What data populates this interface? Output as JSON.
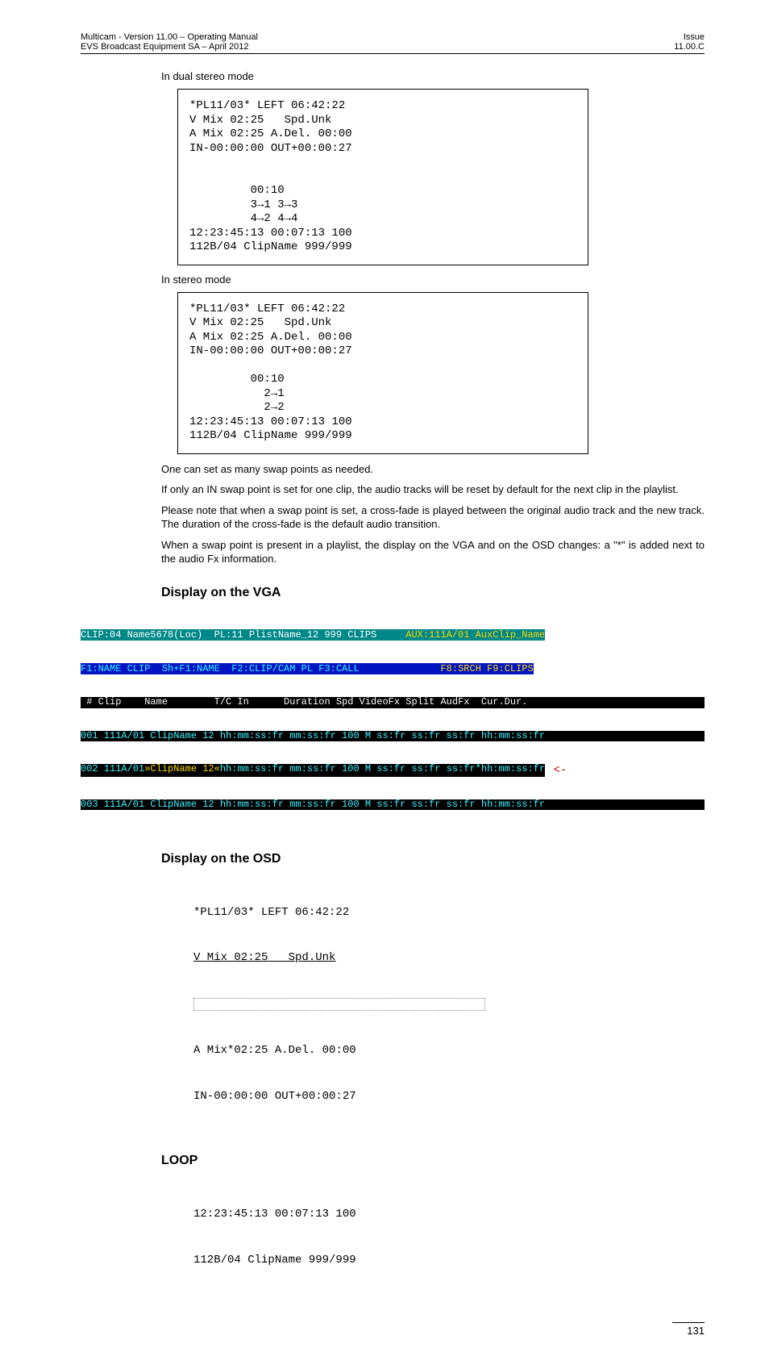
{
  "header": {
    "left_line1": "Multicam - Version 11.00 – Operating Manual",
    "left_line2": "EVS Broadcast Equipment SA – April 2012",
    "right_line1": "Issue",
    "right_line2": "11.00.C"
  },
  "labels": {
    "dual_stereo": "In dual stereo mode",
    "stereo": "In stereo mode"
  },
  "code_dual": "*PL11/03* LEFT 06:42:22\nV Mix 02:25   Spd.Unk\nA Mix 02:25 A.Del. 00:00\nIN-00:00:00 OUT+00:00:27\n\n\n         00:10\n         3→1 3→3\n         4→2 4→4\n12:23:45:13 00:07:13 100\n112B/04 ClipName 999/999",
  "code_stereo": "*PL11/03* LEFT 06:42:22\nV Mix 02:25   Spd.Unk\nA Mix 02:25 A.Del. 00:00\nIN-00:00:00 OUT+00:00:27\n\n         00:10\n           2→1\n           2→2\n12:23:45:13 00:07:13 100\n112B/04 ClipName 999/999",
  "paragraphs": {
    "p1": "One can set as many swap points as needed.",
    "p2": "If only an IN swap point is set for one clip, the audio tracks will be reset by default for the next clip in the playlist.",
    "p3": "Please note that when a swap point is set, a cross-fade is played between the original audio track and the new track. The duration of the cross-fade is the default audio transition.",
    "p4": "When a swap point is present in a playlist, the display on the VGA and on the OSD changes: a \"*\" is added next to the audio Fx information."
  },
  "headings": {
    "vga": "Display on the VGA",
    "osd": "Display on the OSD",
    "loop": "LOOP"
  },
  "vga": {
    "l1a": "CLIP:04 Name5678(Loc)  PL:11 PlistName_12 999 CLIPS     ",
    "l1b": "AUX:111A/01 AuxClip_Name",
    "l2a": "F1:NAME CLIP  Sh+F1:NAME  F2:CLIP/CAM PL F3:CALL",
    "l2b": "              ",
    "l2c": "F8:SRCH F9:CLIPS",
    "l3": " # Clip    Name        T/C In      Duration Spd VideoFx Split AudFx  Cur.Dur. ",
    "l4": "001 111A/01 ClipName 12 hh:mm:ss:fr mm:ss:fr 100 M ss:fr ss:fr ss:fr hh:mm:ss:fr",
    "l5a": "002 111A/01",
    "l5b": "»",
    "l5c": "ClipName 12",
    "l5d": "«",
    "l5e": "hh:mm:ss:fr mm:ss:fr 100 M ss:fr ss:fr ss:fr*hh:mm:ss:fr",
    "l5arrow": " <-",
    "l6": "003 111A/01 ClipName 12 hh:mm:ss:fr mm:ss:fr 100 M ss:fr ss:fr ss:fr hh:mm:ss:fr"
  },
  "osd": {
    "l1": "*PL11/03* LEFT 06:42:22",
    "l2": "V Mix 02:25   Spd.Unk",
    "l3": "A Mix*02:25 A.Del. 00:00",
    "l4": "IN-00:00:00 OUT+00:00:27"
  },
  "loop": {
    "l1": "12:23:45:13 00:07:13 100",
    "l2": "112B/04 ClipName 999/999"
  },
  "page_number": "131"
}
